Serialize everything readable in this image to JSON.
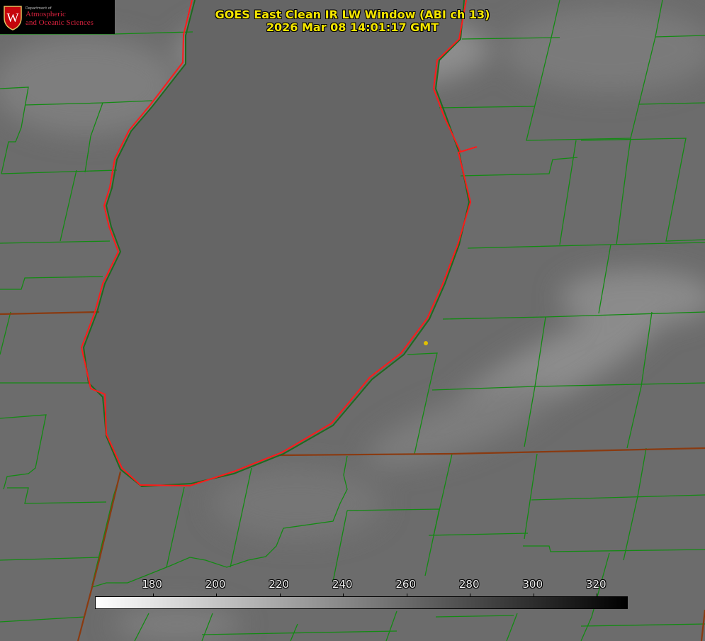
{
  "title": {
    "line1": "GOES East Clean IR LW Window (ABI ch 13)",
    "line2": "2026 Mar 08 14:01:17 GMT"
  },
  "logo": {
    "department": "Department of",
    "name_line1": "Atmospheric",
    "name_line2": "and Oceanic Sciences",
    "seal_letter": "W"
  },
  "colorbar": {
    "min": 162,
    "max": 330,
    "ticks": [
      "180",
      "200",
      "220",
      "240",
      "260",
      "280",
      "300",
      "320"
    ],
    "colors": {
      "low": "#ffffff",
      "high": "#000000"
    }
  },
  "map": {
    "lake_outline_color": "#ff1a1a",
    "county_border_color": "#138a13",
    "marker_color": "#e0c000",
    "icons": [
      "station-marker-dot"
    ]
  }
}
